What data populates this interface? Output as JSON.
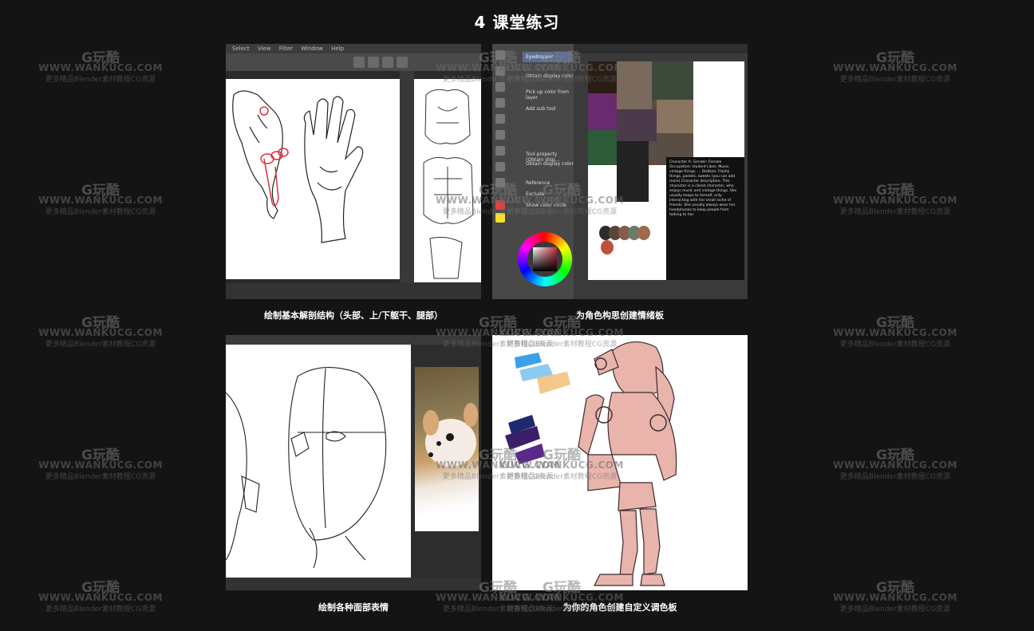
{
  "page": {
    "title": "4 课堂练习"
  },
  "panels": [
    {
      "caption": "绘制基本解剖结构（头部、上/下躯干、腿部）",
      "menu": [
        "Select",
        "View",
        "Filter",
        "Window",
        "Help"
      ]
    },
    {
      "caption": "为角色构思创建情绪板",
      "tool_button": "Eyedropper",
      "tool_texts": [
        "Obtain display color",
        "Pick up color from layer",
        "Add sub tool",
        "Tool property (Obtain disp...",
        "Obtain display color",
        "Reference",
        "Exclude",
        "Show color circle"
      ],
      "description": "Character A: Gender: Female Occupation: student Likes: Music, vintage things, ... Dislikes: Flashy things, pastels, sweets (you can add more) Character description: This character is a closet character, who enjoys music and vintage things. She usually keeps to herself, only interacting with her small niche of friends. She usually always wear her headphones to keep people from talking to her.",
      "palette_colors": [
        "#2b2b2b",
        "#5a4636",
        "#8a5a4a",
        "#6b7b6a",
        "#a06a50",
        "#c0503a"
      ]
    },
    {
      "caption": "绘制各种面部表情"
    },
    {
      "caption": "为你的角色创建自定义调色板",
      "swatch_colors": [
        "#3aa0e8",
        "#8ecaf0",
        "#f2c98a",
        "#1f2a6e",
        "#3b1f6a",
        "#5a2a8a"
      ],
      "figure_color": "#e8b4ac"
    }
  ],
  "watermark": {
    "logo": "G玩酷",
    "url": "WWW.WANKUCG.COM",
    "sub": "更多精品Blender素材教程CG资源"
  }
}
